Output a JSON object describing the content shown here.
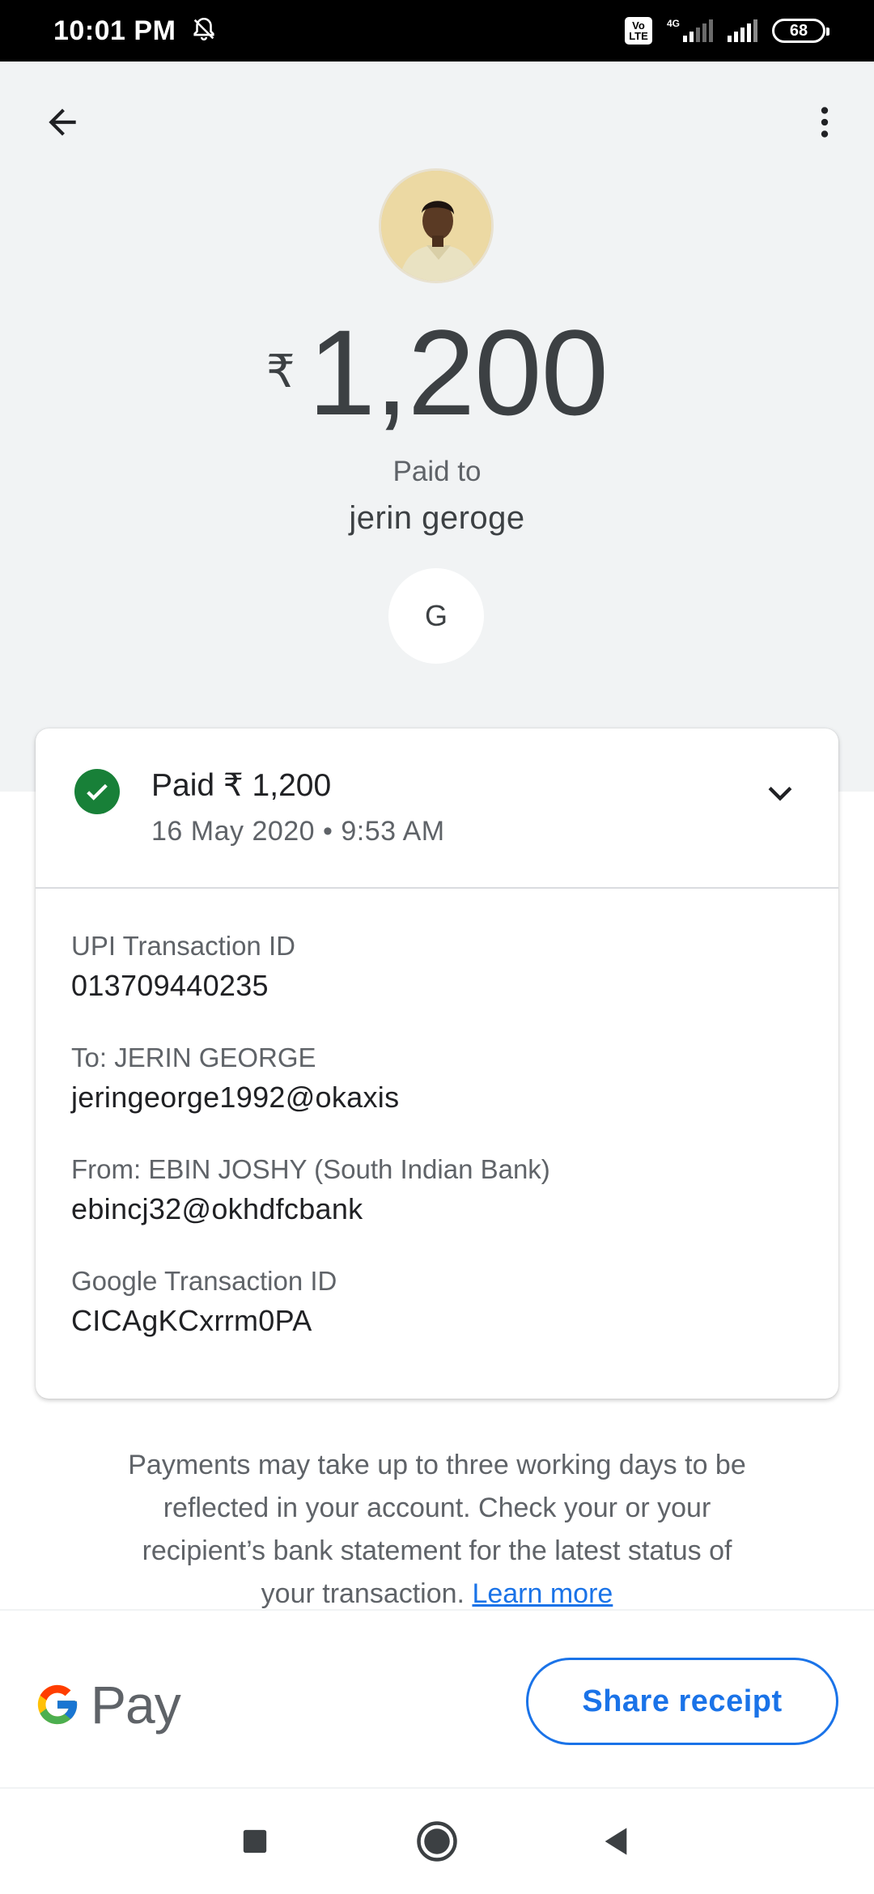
{
  "status_bar": {
    "time": "10:01 PM",
    "volte": "Vo LTE",
    "network": "4G",
    "battery": "68",
    "icons": [
      "alarm-off-icon",
      "volte-icon",
      "signal-icon",
      "signal-icon",
      "battery-icon"
    ]
  },
  "header": {
    "back_icon": "arrow-back-icon",
    "more_icon": "more-vert-icon",
    "currency_symbol": "₹",
    "amount": "1,200",
    "paid_to_label": "Paid to",
    "payee_name": "jerin geroge",
    "payee_initial": "G"
  },
  "transaction": {
    "status_text": "Paid ₹ 1,200",
    "datetime": "16 May 2020 • 9:53 AM",
    "status_icon": "check-circle-icon",
    "expand_icon": "chevron-down-icon",
    "status_color": "#188038",
    "details": [
      {
        "label": "UPI Transaction ID",
        "value": "013709440235"
      },
      {
        "label": "To: JERIN GEORGE",
        "value": "jeringeorge1992@okaxis"
      },
      {
        "label": "From: EBIN JOSHY (South Indian Bank)",
        "value": "ebincj32@okhdfcbank"
      },
      {
        "label": "Google Transaction ID",
        "value": "CICAgKCxrrm0PA"
      }
    ]
  },
  "disclaimer": {
    "text": "Payments may take up to three working days to be reflected in your account. Check your or your recipient’s bank statement for the latest status of your transaction. ",
    "link": "Learn more"
  },
  "footer": {
    "brand_text": "Pay",
    "share_button": "Share receipt",
    "accent_color": "#1a73e8"
  },
  "nav": {
    "icons": [
      "recents-square-icon",
      "home-circle-icon",
      "back-triangle-icon"
    ]
  }
}
